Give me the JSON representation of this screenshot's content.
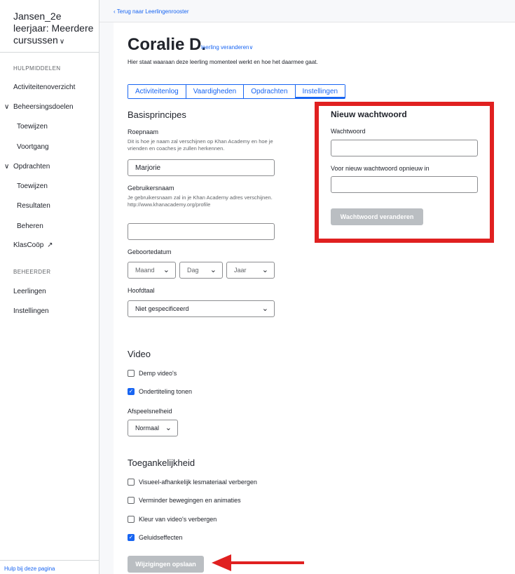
{
  "sidebar": {
    "course_title": "Jansen_2e leerjaar: Meerdere cursussen",
    "sections": {
      "tools": "HULPMIDDELEN",
      "admin": "BEHEERDER"
    },
    "items": {
      "activity": "Activiteitenoverzicht",
      "mastery_goals": "Beheersingsdoelen",
      "mastery_assign": "Toewijzen",
      "mastery_progress": "Voortgang",
      "assignments": "Opdrachten",
      "assignments_assign": "Toewijzen",
      "assignments_results": "Resultaten",
      "assignments_manage": "Beheren",
      "klascoop": "KlasCoöp",
      "students": "Leerlingen",
      "settings": "Instellingen"
    },
    "help_link": "Hulp bij deze pagina"
  },
  "header": {
    "back_link": "Terug naar Leerlingenrooster",
    "student_name": "Coralie D.",
    "change_student": "leerling veranderen",
    "subtitle": "Hier staat waaraan deze leerling momenteel werkt en hoe het daarmee gaat."
  },
  "tabs": [
    "Activiteitenlog",
    "Vaardigheden",
    "Opdrachten",
    "Instellingen"
  ],
  "active_tab": "Instellingen",
  "basics": {
    "title": "Basisprincipes",
    "nickname_label": "Roepnaam",
    "nickname_help": "Dit is hoe je naam zal verschijnen op Khan Academy en hoe je vrienden en coaches je zullen herkennen.",
    "nickname_value": "Marjorie",
    "username_label": "Gebruikersnaam",
    "username_help": "Je gebruikersnaam zal in je Khan Academy adres verschijnen.",
    "username_url": "http://www.khanacademy.org/profile",
    "username_value": "",
    "birthdate_label": "Geboortedatum",
    "month": "Maand",
    "day": "Dag",
    "year": "Jaar",
    "language_label": "Hoofdtaal",
    "language_value": "Niet gespecificeerd"
  },
  "video": {
    "title": "Video",
    "mute_label": "Demp video's",
    "mute_checked": false,
    "subtitles_label": "Ondertiteling tonen",
    "subtitles_checked": true,
    "speed_label": "Afspeelsnelheid",
    "speed_value": "Normaal"
  },
  "accessibility": {
    "title": "Toegankelijkheid",
    "hide_visual": "Visueel-afhankelijk lesmateriaal verbergen",
    "hide_visual_checked": false,
    "reduce_motion": "Verminder bewegingen en animaties",
    "reduce_motion_checked": false,
    "hide_video_color": "Kleur van video's verbergen",
    "hide_video_color_checked": false,
    "sound_effects": "Geluidseffecten",
    "sound_effects_checked": true
  },
  "save_button": "Wijzigingen opslaan",
  "password": {
    "title": "Nieuw wachtwoord",
    "password_label": "Wachtwoord",
    "confirm_label": "Voor nieuw wachtwoord opnieuw in",
    "change_button": "Wachtwoord veranderen"
  },
  "colors": {
    "accent": "#1865f2",
    "highlight": "#e02020",
    "disabled": "#babec2"
  }
}
